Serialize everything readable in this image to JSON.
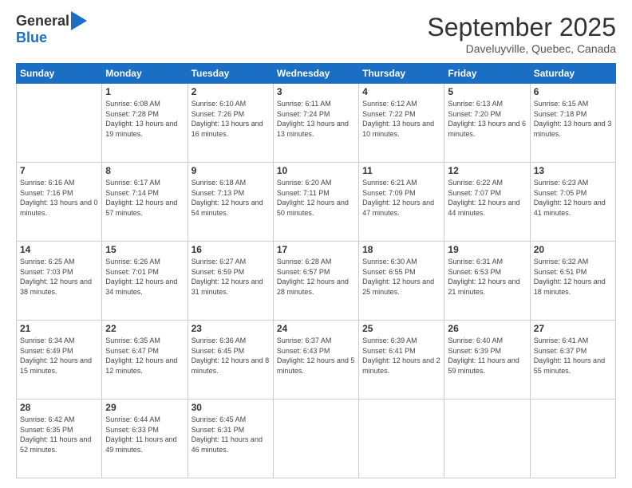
{
  "logo": {
    "general": "General",
    "blue": "Blue"
  },
  "title": {
    "month": "September 2025",
    "location": "Daveluyville, Quebec, Canada"
  },
  "weekdays": [
    "Sunday",
    "Monday",
    "Tuesday",
    "Wednesday",
    "Thursday",
    "Friday",
    "Saturday"
  ],
  "weeks": [
    [
      {
        "day": "",
        "sunrise": "",
        "sunset": "",
        "daylight": ""
      },
      {
        "day": "1",
        "sunrise": "Sunrise: 6:08 AM",
        "sunset": "Sunset: 7:28 PM",
        "daylight": "Daylight: 13 hours and 19 minutes."
      },
      {
        "day": "2",
        "sunrise": "Sunrise: 6:10 AM",
        "sunset": "Sunset: 7:26 PM",
        "daylight": "Daylight: 13 hours and 16 minutes."
      },
      {
        "day": "3",
        "sunrise": "Sunrise: 6:11 AM",
        "sunset": "Sunset: 7:24 PM",
        "daylight": "Daylight: 13 hours and 13 minutes."
      },
      {
        "day": "4",
        "sunrise": "Sunrise: 6:12 AM",
        "sunset": "Sunset: 7:22 PM",
        "daylight": "Daylight: 13 hours and 10 minutes."
      },
      {
        "day": "5",
        "sunrise": "Sunrise: 6:13 AM",
        "sunset": "Sunset: 7:20 PM",
        "daylight": "Daylight: 13 hours and 6 minutes."
      },
      {
        "day": "6",
        "sunrise": "Sunrise: 6:15 AM",
        "sunset": "Sunset: 7:18 PM",
        "daylight": "Daylight: 13 hours and 3 minutes."
      }
    ],
    [
      {
        "day": "7",
        "sunrise": "Sunrise: 6:16 AM",
        "sunset": "Sunset: 7:16 PM",
        "daylight": "Daylight: 13 hours and 0 minutes."
      },
      {
        "day": "8",
        "sunrise": "Sunrise: 6:17 AM",
        "sunset": "Sunset: 7:14 PM",
        "daylight": "Daylight: 12 hours and 57 minutes."
      },
      {
        "day": "9",
        "sunrise": "Sunrise: 6:18 AM",
        "sunset": "Sunset: 7:13 PM",
        "daylight": "Daylight: 12 hours and 54 minutes."
      },
      {
        "day": "10",
        "sunrise": "Sunrise: 6:20 AM",
        "sunset": "Sunset: 7:11 PM",
        "daylight": "Daylight: 12 hours and 50 minutes."
      },
      {
        "day": "11",
        "sunrise": "Sunrise: 6:21 AM",
        "sunset": "Sunset: 7:09 PM",
        "daylight": "Daylight: 12 hours and 47 minutes."
      },
      {
        "day": "12",
        "sunrise": "Sunrise: 6:22 AM",
        "sunset": "Sunset: 7:07 PM",
        "daylight": "Daylight: 12 hours and 44 minutes."
      },
      {
        "day": "13",
        "sunrise": "Sunrise: 6:23 AM",
        "sunset": "Sunset: 7:05 PM",
        "daylight": "Daylight: 12 hours and 41 minutes."
      }
    ],
    [
      {
        "day": "14",
        "sunrise": "Sunrise: 6:25 AM",
        "sunset": "Sunset: 7:03 PM",
        "daylight": "Daylight: 12 hours and 38 minutes."
      },
      {
        "day": "15",
        "sunrise": "Sunrise: 6:26 AM",
        "sunset": "Sunset: 7:01 PM",
        "daylight": "Daylight: 12 hours and 34 minutes."
      },
      {
        "day": "16",
        "sunrise": "Sunrise: 6:27 AM",
        "sunset": "Sunset: 6:59 PM",
        "daylight": "Daylight: 12 hours and 31 minutes."
      },
      {
        "day": "17",
        "sunrise": "Sunrise: 6:28 AM",
        "sunset": "Sunset: 6:57 PM",
        "daylight": "Daylight: 12 hours and 28 minutes."
      },
      {
        "day": "18",
        "sunrise": "Sunrise: 6:30 AM",
        "sunset": "Sunset: 6:55 PM",
        "daylight": "Daylight: 12 hours and 25 minutes."
      },
      {
        "day": "19",
        "sunrise": "Sunrise: 6:31 AM",
        "sunset": "Sunset: 6:53 PM",
        "daylight": "Daylight: 12 hours and 21 minutes."
      },
      {
        "day": "20",
        "sunrise": "Sunrise: 6:32 AM",
        "sunset": "Sunset: 6:51 PM",
        "daylight": "Daylight: 12 hours and 18 minutes."
      }
    ],
    [
      {
        "day": "21",
        "sunrise": "Sunrise: 6:34 AM",
        "sunset": "Sunset: 6:49 PM",
        "daylight": "Daylight: 12 hours and 15 minutes."
      },
      {
        "day": "22",
        "sunrise": "Sunrise: 6:35 AM",
        "sunset": "Sunset: 6:47 PM",
        "daylight": "Daylight: 12 hours and 12 minutes."
      },
      {
        "day": "23",
        "sunrise": "Sunrise: 6:36 AM",
        "sunset": "Sunset: 6:45 PM",
        "daylight": "Daylight: 12 hours and 8 minutes."
      },
      {
        "day": "24",
        "sunrise": "Sunrise: 6:37 AM",
        "sunset": "Sunset: 6:43 PM",
        "daylight": "Daylight: 12 hours and 5 minutes."
      },
      {
        "day": "25",
        "sunrise": "Sunrise: 6:39 AM",
        "sunset": "Sunset: 6:41 PM",
        "daylight": "Daylight: 12 hours and 2 minutes."
      },
      {
        "day": "26",
        "sunrise": "Sunrise: 6:40 AM",
        "sunset": "Sunset: 6:39 PM",
        "daylight": "Daylight: 11 hours and 59 minutes."
      },
      {
        "day": "27",
        "sunrise": "Sunrise: 6:41 AM",
        "sunset": "Sunset: 6:37 PM",
        "daylight": "Daylight: 11 hours and 55 minutes."
      }
    ],
    [
      {
        "day": "28",
        "sunrise": "Sunrise: 6:42 AM",
        "sunset": "Sunset: 6:35 PM",
        "daylight": "Daylight: 11 hours and 52 minutes."
      },
      {
        "day": "29",
        "sunrise": "Sunrise: 6:44 AM",
        "sunset": "Sunset: 6:33 PM",
        "daylight": "Daylight: 11 hours and 49 minutes."
      },
      {
        "day": "30",
        "sunrise": "Sunrise: 6:45 AM",
        "sunset": "Sunset: 6:31 PM",
        "daylight": "Daylight: 11 hours and 46 minutes."
      },
      {
        "day": "",
        "sunrise": "",
        "sunset": "",
        "daylight": ""
      },
      {
        "day": "",
        "sunrise": "",
        "sunset": "",
        "daylight": ""
      },
      {
        "day": "",
        "sunrise": "",
        "sunset": "",
        "daylight": ""
      },
      {
        "day": "",
        "sunrise": "",
        "sunset": "",
        "daylight": ""
      }
    ]
  ]
}
